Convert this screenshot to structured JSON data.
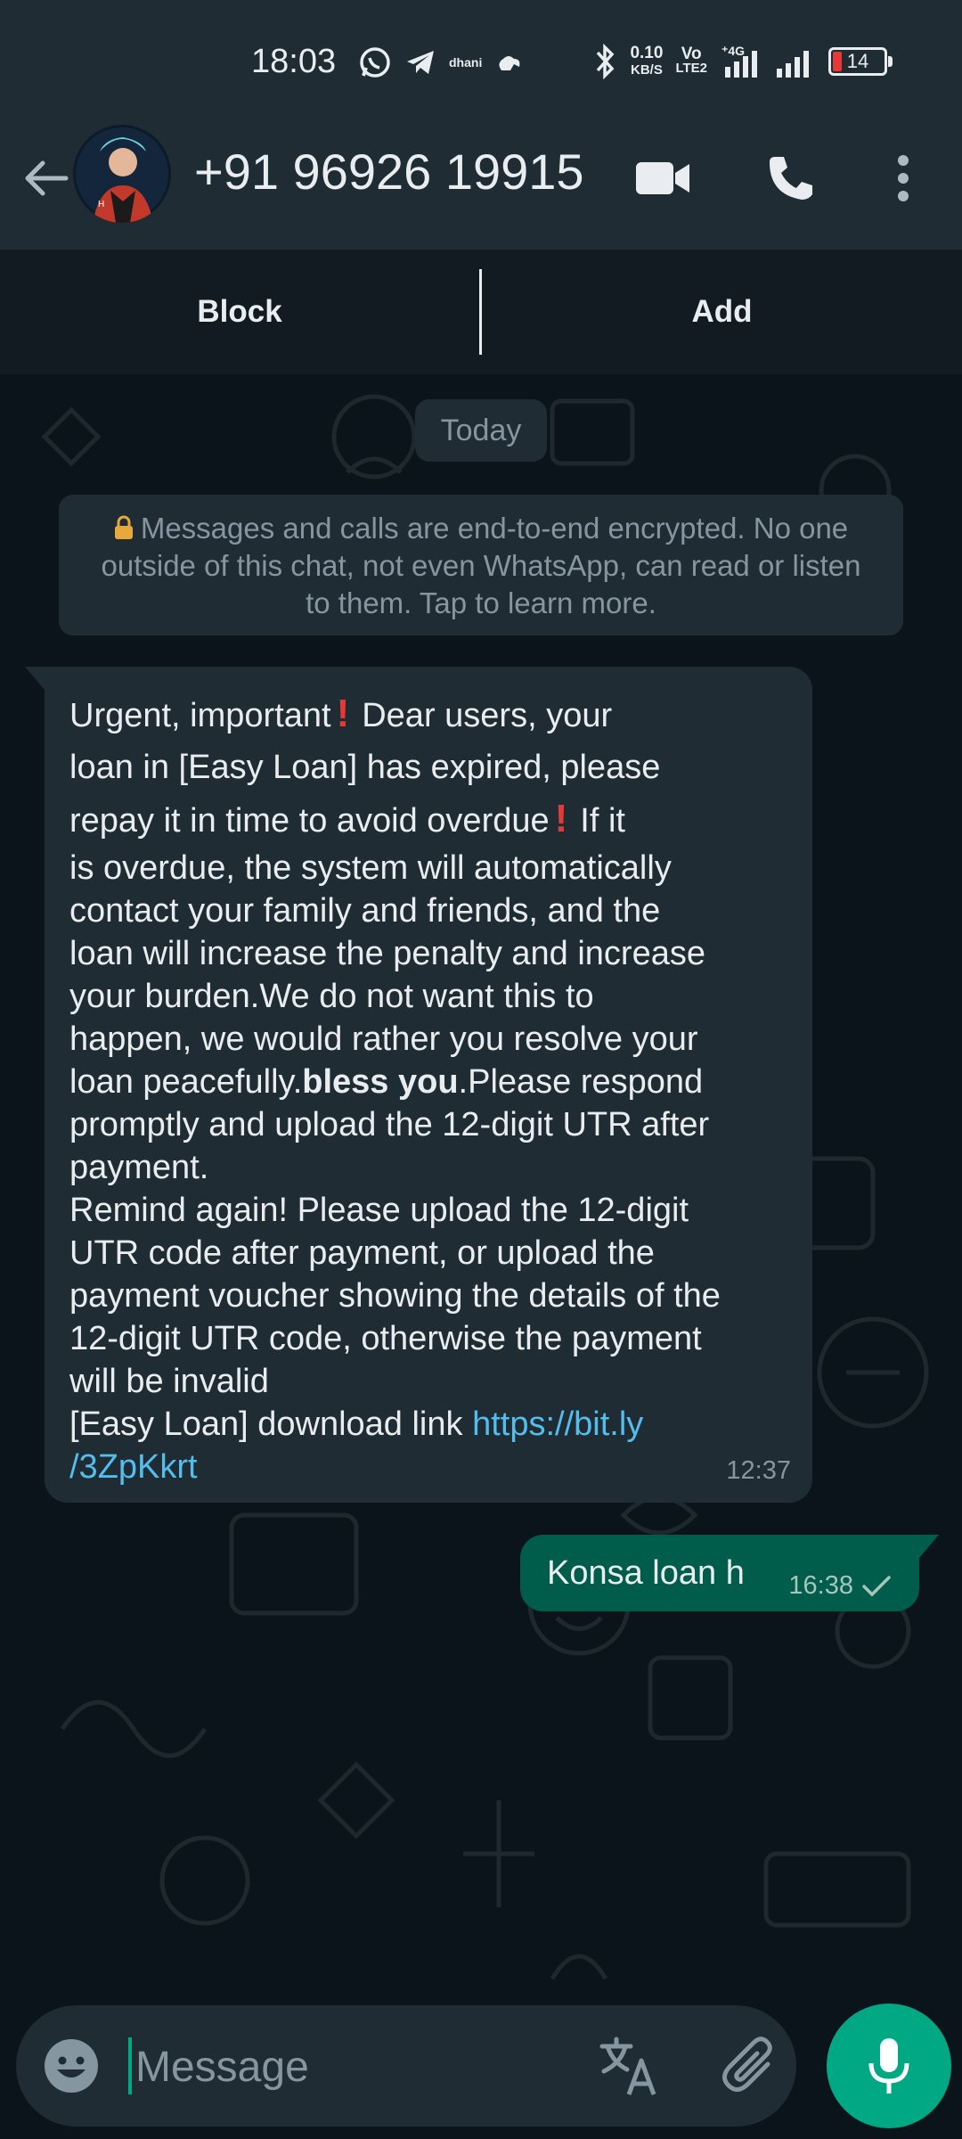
{
  "status_bar": {
    "time": "18:03",
    "mini_label": "dhani",
    "speed_value": "0.10",
    "speed_unit": "KB/S",
    "volte_top": "Vo",
    "volte_bottom": "LTE2",
    "network": "4G",
    "battery": "14",
    "icons": [
      "whatsapp-icon",
      "telegram-icon",
      "cloud-icon",
      "bluetooth-icon",
      "signal-icon",
      "signal-icon",
      "battery-icon"
    ]
  },
  "header": {
    "contact": "+91 96926 19915",
    "icons": [
      "back-arrow-icon",
      "video-call-icon",
      "phone-icon",
      "more-vert-icon"
    ]
  },
  "actions": {
    "block": "Block",
    "add": "Add"
  },
  "chat": {
    "date": "Today",
    "encryption_notice": "Messages and calls are end-to-end encrypted. No one outside of this chat, not even WhatsApp, can read or listen to them. Tap to learn more.",
    "incoming": {
      "line1_a": "Urgent, important",
      "line1_b": "Dear users, your",
      "line2": "loan in [Easy Loan] has expired, please",
      "line3_a": "repay it in time to avoid overdue",
      "line3_b": "If it",
      "line4": "is overdue, the system will automatically",
      "line5": "contact your family and friends, and the",
      "line6": "loan will increase the penalty and increase",
      "line7": "your burden.We do not want this to",
      "line8": "happen, we would rather you resolve your",
      "line9_a": "loan peacefully.",
      "line9_b": "bless you",
      "line9_c": ".Please respond",
      "line10": "promptly and upload the 12-digit UTR after",
      "line11": "payment.",
      "line12": "Remind again! Please upload the 12-digit",
      "line13": "UTR code after payment, or upload the",
      "line14": "payment voucher showing the details of the",
      "line15": "12-digit UTR code, otherwise the payment",
      "line16": "will be invalid",
      "line17_a": "[Easy Loan] download link ",
      "link_part1": "https://bit.ly",
      "link_part2": "/3ZpKkrt",
      "time": "12:37"
    },
    "outgoing": {
      "text": "Konsa loan h",
      "time": "16:38"
    }
  },
  "input": {
    "placeholder": "Message",
    "icons": [
      "emoji-icon",
      "translate-icon",
      "attach-icon",
      "mic-icon"
    ]
  },
  "colors": {
    "header_bg": "#1f2c34",
    "chat_bg": "#0b141a",
    "incoming_bubble": "#1f2c34",
    "outgoing_bubble": "#005c4b",
    "accent": "#00a884",
    "link": "#53bdeb"
  }
}
